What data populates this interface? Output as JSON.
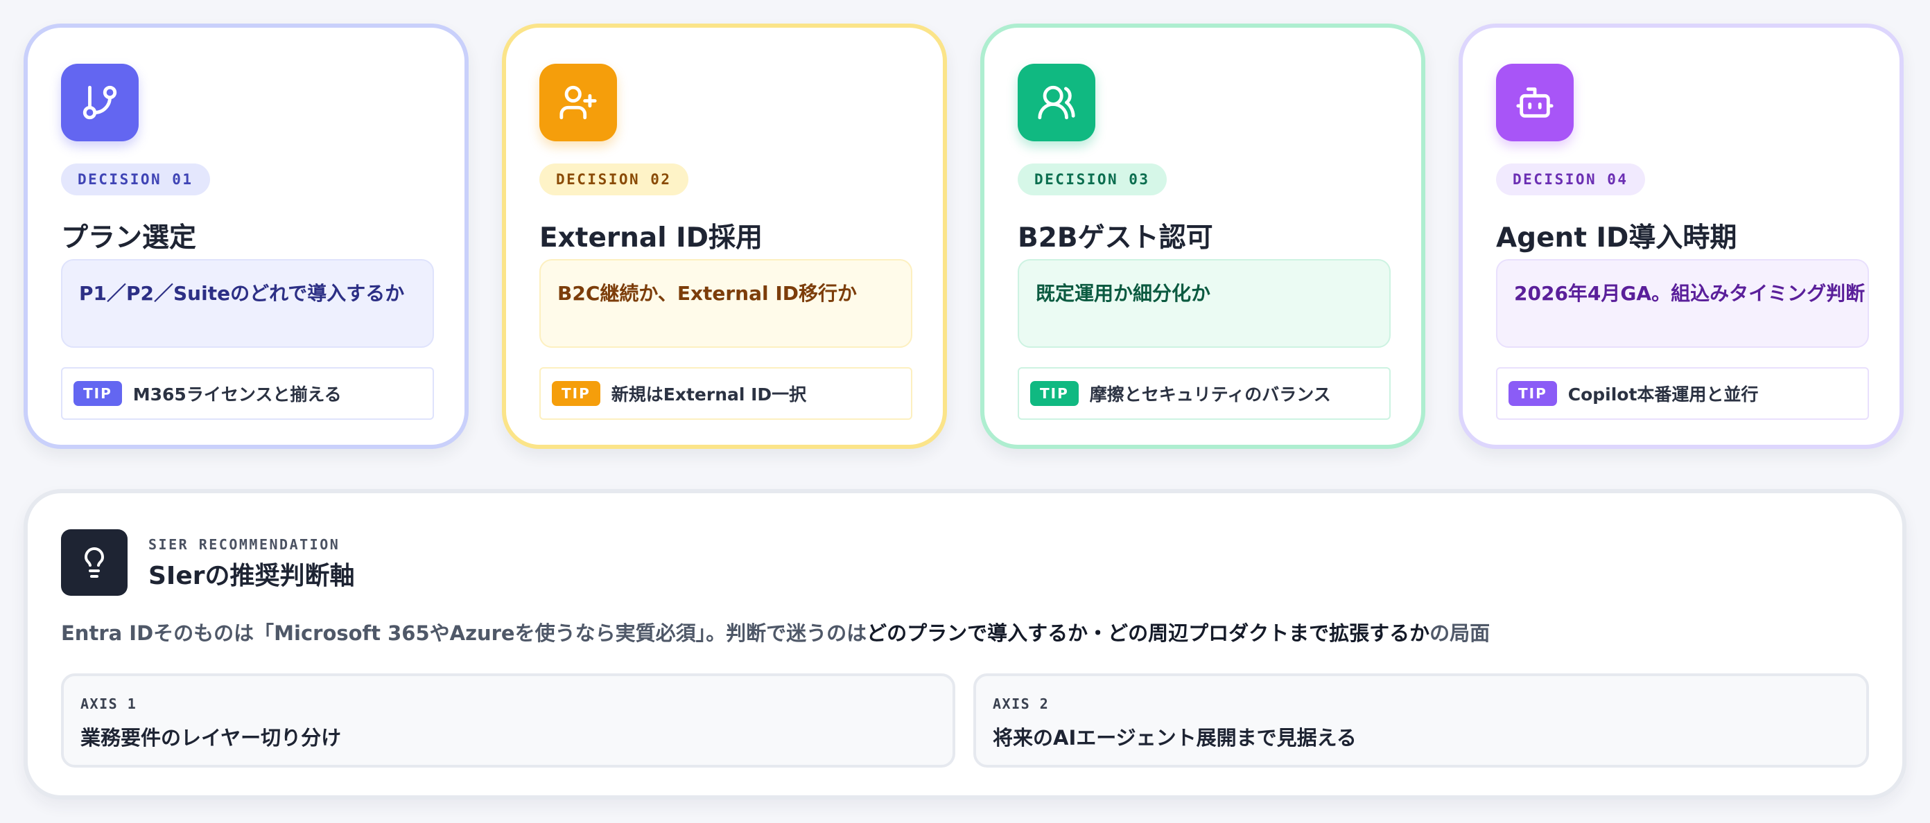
{
  "decisions": [
    {
      "icon": "git-branch-icon",
      "badge": "DECISION 01",
      "title": "プラン選定",
      "question": "P1／P2／Suiteのどれで導入するか",
      "tip_label": "TIP",
      "tip": "M365ライセンスと揃える",
      "accent": "#6366f1"
    },
    {
      "icon": "user-plus-icon",
      "badge": "DECISION 02",
      "title": "External ID採用",
      "question": "B2C継続か、External ID移行か",
      "tip_label": "TIP",
      "tip": "新規はExternal ID一択",
      "accent": "#f59e0b"
    },
    {
      "icon": "users-icon",
      "badge": "DECISION 03",
      "title": "B2Bゲスト認可",
      "question": "既定運用か細分化か",
      "tip_label": "TIP",
      "tip": "摩擦とセキュリティのバランス",
      "accent": "#10b981"
    },
    {
      "icon": "bot-icon",
      "badge": "DECISION 04",
      "title": "Agent ID導入時期",
      "question": "2026年4月GA。組込みタイミング判断",
      "tip_label": "TIP",
      "tip": "Copilot本番運用と並行",
      "accent": "#a855f7"
    }
  ],
  "recommendation": {
    "icon": "lightbulb-icon",
    "kicker": "SIER RECOMMENDATION",
    "title": "SIerの推奨判断軸",
    "summary_prefix": "Entra IDそのものは「Microsoft 365やAzureを使うなら実質必須」。判断で迷うのは",
    "summary_emphasis": "どのプランで導入するか・どの周辺プロダクトまで拡張するか",
    "summary_suffix": "の局面",
    "axes": [
      {
        "label": "AXIS 1",
        "text": "業務要件のレイヤー切り分け"
      },
      {
        "label": "AXIS 2",
        "text": "将来のAIエージェント展開まで見据える"
      }
    ]
  }
}
